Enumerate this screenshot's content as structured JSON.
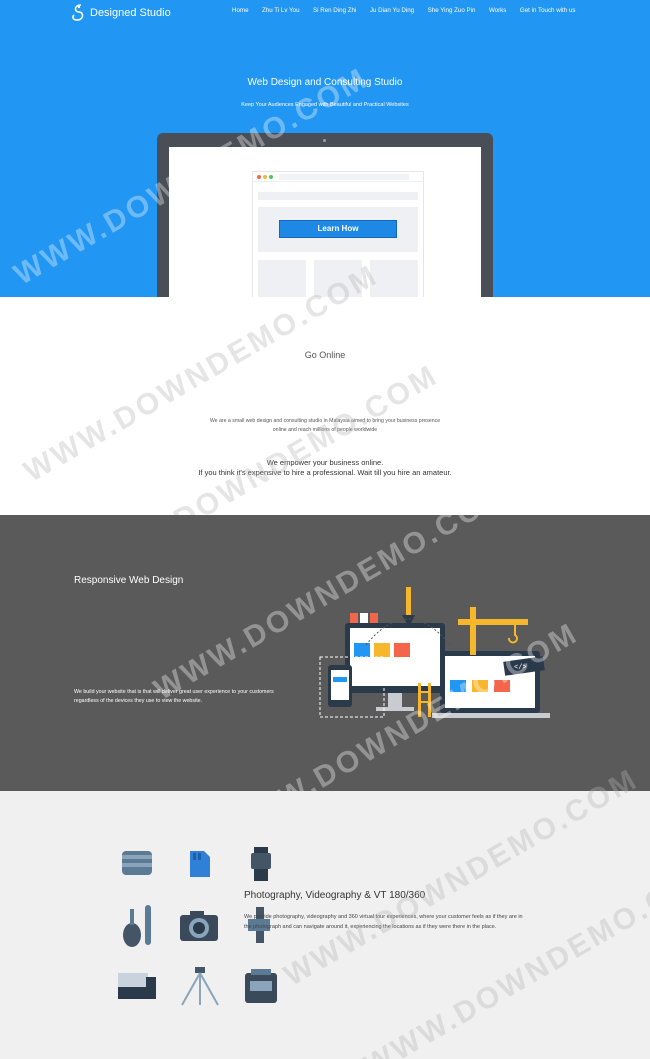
{
  "brand": {
    "name": "Designed Studio",
    "icon": "ds-logo-icon"
  },
  "nav": [
    "Home",
    "Zhu Ti Lv You",
    "Si Ren Ding Zhi",
    "Ju Dian Yu Ding",
    "She Ying Zuo Pin",
    "Works",
    "Get in Touch with us"
  ],
  "hero": {
    "title": "Web Design and Consulting Studio",
    "subtitle": "Keep Your Audiences Engaged with Beautiful and Practical Websites",
    "button": "Learn How"
  },
  "go_online": {
    "title": "Go Online",
    "text": "We are a small web design and consulting studio in Malaysia aimed to bring your business presence online and reach millions of people worldwide",
    "empower_1": "We empower your business online.",
    "empower_2": "If you think it's expensive to hire a professional. Wait till you hire an amateur."
  },
  "responsive": {
    "title": "Responsive Web Design",
    "text": "We build your website that is that will deliver great user experience to your customers regardless of the devices they use to view the website."
  },
  "photography": {
    "title": "Photography, Videography & VT 180/360",
    "text": "We provide photography, videography and 360 virtual tour experiences, where your customer feels as if they are in the photograph and can navigate around it, experiencing the locations as if they were there in the place."
  },
  "watermark": "WWW.DOWNDEMO.COM",
  "colors": {
    "hero_bg": "#2196f3",
    "responsive_bg": "#5a5a5a",
    "photo_bg": "#f0f0f0",
    "button": "#1e88e5"
  }
}
